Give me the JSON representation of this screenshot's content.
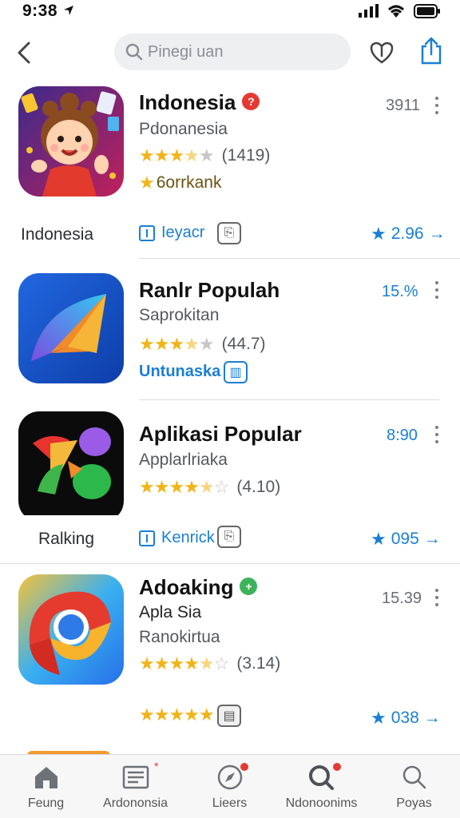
{
  "status": {
    "time": "9:38"
  },
  "search": {
    "placeholder": "Pinegi uan"
  },
  "apps": [
    {
      "title": "Indonesia",
      "subtitle": "Pdonanesia",
      "rating_value": 3.5,
      "rating_count": "(1419)",
      "value": "3911",
      "extra_line": "6orrkank",
      "row_label": "Indonesia",
      "chip_label": "Ieyacr",
      "link_value": "2.96"
    },
    {
      "title": "Ranlr Populah",
      "subtitle": "Saprokitan",
      "rating_value": 3.5,
      "rating_count": "(44.7)",
      "value": "15.%",
      "extra_line": "Untunaska"
    },
    {
      "title": "Aplikasi Popular",
      "subtitle": "Applarlriaka",
      "rating_value": 4.5,
      "rating_count": "(4.10)",
      "value": "8:90",
      "row_label": "Ralking",
      "chip_label": "Kenrick",
      "link_value": "095"
    },
    {
      "title": "Adoaking",
      "subtitle": "Apla Sia",
      "subtitle2": "Ranokirtua",
      "rating_value": 4.5,
      "rating_count": "(3.14)",
      "value": "15.39",
      "link_value": "038"
    }
  ],
  "tabs": [
    {
      "label": "Feung",
      "icon": "home-icon"
    },
    {
      "label": "Ardononsia",
      "icon": "news-icon"
    },
    {
      "label": "Lieers",
      "icon": "compass-icon"
    },
    {
      "label": "Ndonoonims",
      "icon": "search-badge-icon"
    },
    {
      "label": "Poyas",
      "icon": "search-icon"
    }
  ],
  "colors": {
    "accent": "#1a7fd4",
    "star": "#f1b417",
    "badge_red": "#e43a33",
    "badge_green": "#3cb35a"
  }
}
